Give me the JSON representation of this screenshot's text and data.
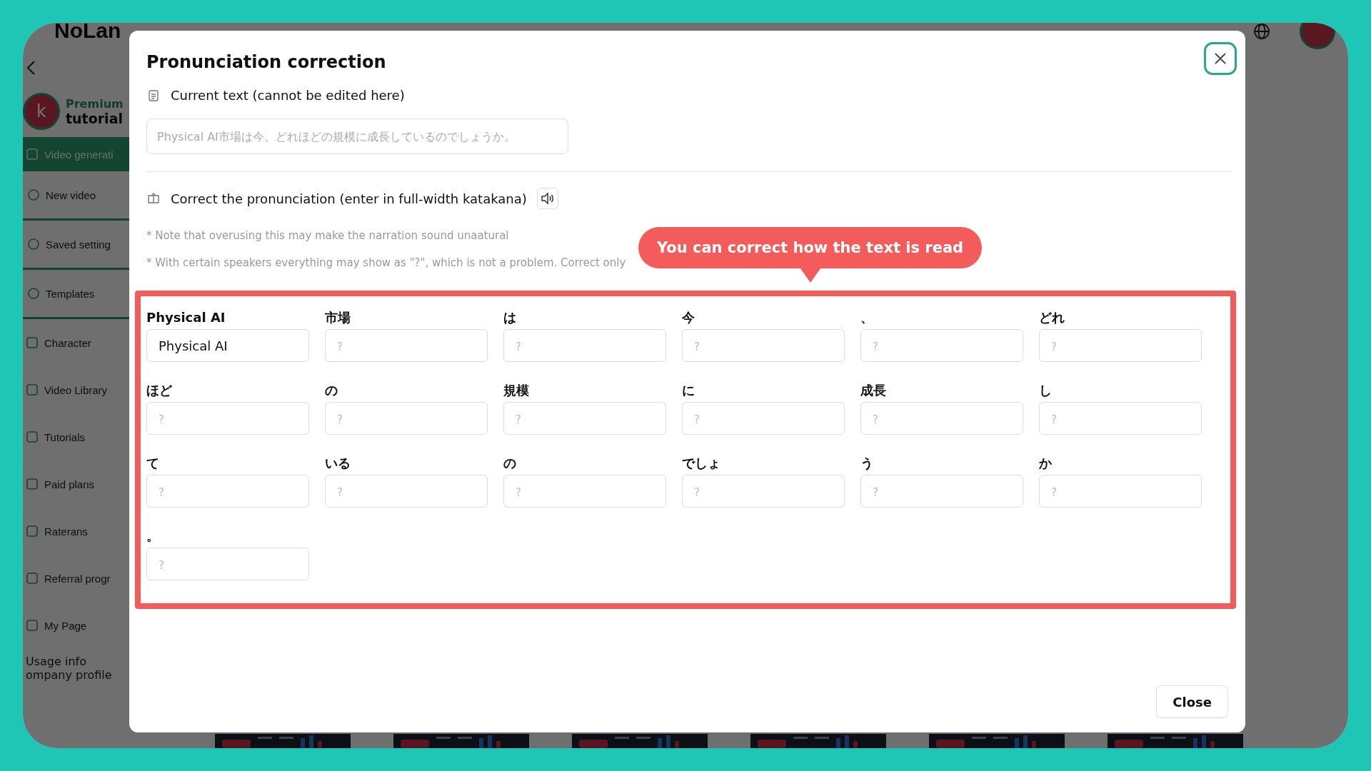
{
  "app": {
    "logo": "NoLan",
    "plan": "Premium",
    "user": "tutorial",
    "avatar": "k",
    "sidebar": [
      {
        "label": "Video generati",
        "selected": true,
        "children": [
          {
            "label": "New video",
            "selected": false
          },
          {
            "label": "Saved setting",
            "selected": false
          },
          {
            "label": "Templates",
            "selected": false
          }
        ]
      },
      {
        "label": "Character",
        "selected": false
      },
      {
        "label": "Video Library",
        "selected": false
      },
      {
        "label": "Tutorials",
        "selected": false
      },
      {
        "label": "Paid plans",
        "selected": false
      },
      {
        "label": "Raterans",
        "selected": false
      },
      {
        "label": "Referral progr",
        "selected": false
      },
      {
        "label": "My Page",
        "selected": false
      }
    ],
    "footer_links": [
      "Usage info",
      "ompany profile"
    ]
  },
  "dialog": {
    "title": "Pronunciation correction",
    "current_text": {
      "label": "Current text (cannot be edited here)",
      "placeholder": "Physical AI市場は今、どれほどの規模に成長しているのでしょうか。"
    },
    "correction": {
      "label": "Correct the pronunciation (enter in full-width katakana)",
      "notes": [
        "* Note that overusing this may make the narration sound unaatural",
        "* With certain speakers everything may show as \"?\", which is not a problem. Correct only"
      ]
    },
    "tooltip": "You can correct how the text is read",
    "tokens": [
      {
        "word": "Physical AI",
        "value": "Physical AI"
      },
      {
        "word": "市場",
        "placeholder": "?"
      },
      {
        "word": "は",
        "placeholder": "?"
      },
      {
        "word": "今",
        "placeholder": "?"
      },
      {
        "word": "、",
        "placeholder": "?"
      },
      {
        "word": "どれ",
        "placeholder": "?"
      },
      {
        "word": "ほど",
        "placeholder": "?"
      },
      {
        "word": "の",
        "placeholder": "?"
      },
      {
        "word": "規模",
        "placeholder": "?"
      },
      {
        "word": "に",
        "placeholder": "?"
      },
      {
        "word": "成長",
        "placeholder": "?"
      },
      {
        "word": "し",
        "placeholder": "?"
      },
      {
        "word": "て",
        "placeholder": "?"
      },
      {
        "word": "いる",
        "placeholder": "?"
      },
      {
        "word": "の",
        "placeholder": "?"
      },
      {
        "word": "でしょ",
        "placeholder": "?"
      },
      {
        "word": "う",
        "placeholder": "?"
      },
      {
        "word": "か",
        "placeholder": "?"
      },
      {
        "word": "。",
        "placeholder": "?"
      }
    ],
    "close_button": "Close"
  }
}
